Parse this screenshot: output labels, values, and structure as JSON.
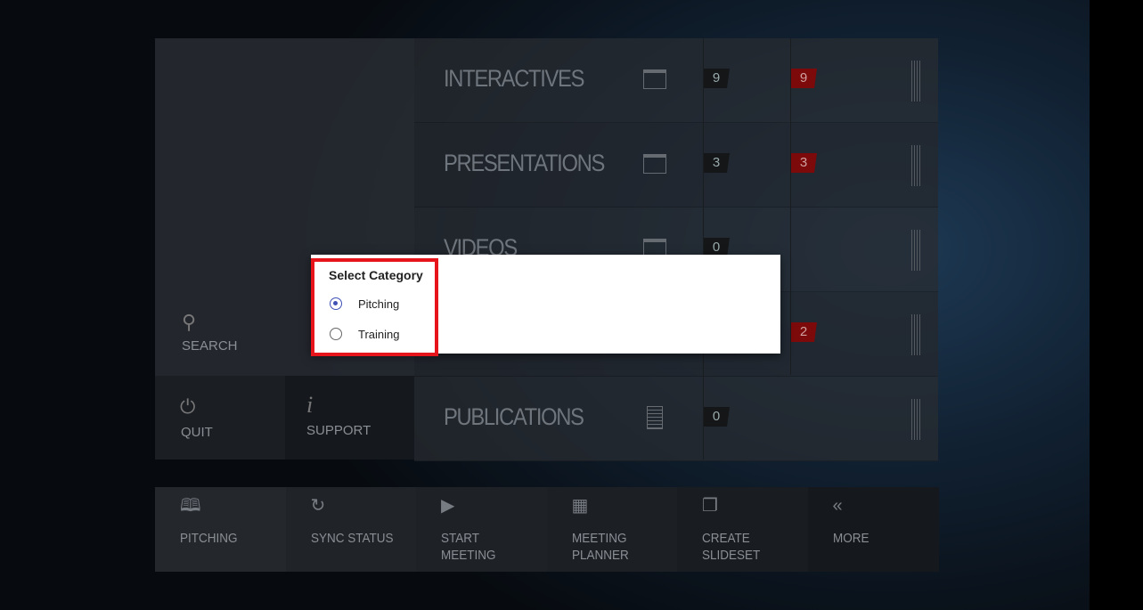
{
  "categories": [
    {
      "label": "INTERACTIVES",
      "icon": "folder-icon",
      "count": "9",
      "new_count": "9"
    },
    {
      "label": "PRESENTATIONS",
      "icon": "folder-icon",
      "count": "3",
      "new_count": "3"
    },
    {
      "label": "VIDEOS",
      "icon": "folder-icon",
      "count": "0",
      "new_count": null
    },
    {
      "label": "",
      "icon": "",
      "count": "",
      "new_count": "2"
    },
    {
      "label": "PUBLICATIONS",
      "icon": "document-icon",
      "count": "0",
      "new_count": null
    }
  ],
  "side": {
    "search": "SEARCH",
    "quit": "QUIT",
    "support": "SUPPORT"
  },
  "bottom": [
    {
      "label": "PITCHING",
      "icon": "book-icon"
    },
    {
      "label": "SYNC STATUS",
      "icon": "sync-icon"
    },
    {
      "label": "START MEETING",
      "icon": "play-icon"
    },
    {
      "label": "MEETING PLANNER",
      "icon": "grid-icon"
    },
    {
      "label": "CREATE SLIDESET",
      "icon": "copy-icon"
    },
    {
      "label": "MORE",
      "icon": "double-chevron-left-icon"
    }
  ],
  "dialog": {
    "title": "Select Category",
    "options": [
      {
        "label": "Pitching",
        "selected": true
      },
      {
        "label": "Training",
        "selected": false
      }
    ]
  },
  "colors": {
    "badge_red": "#7d0a0a",
    "highlight": "#e8141c",
    "radio_selected": "#3f51b5"
  }
}
